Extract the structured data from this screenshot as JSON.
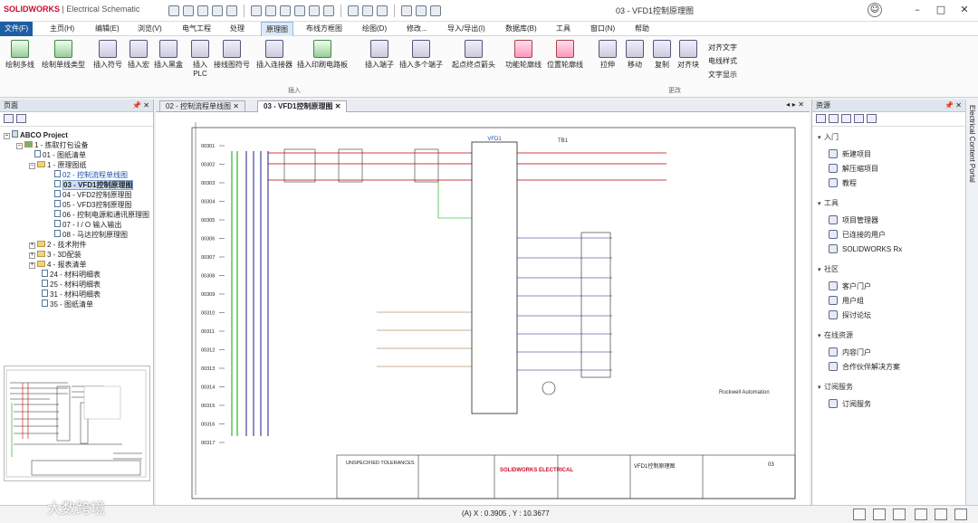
{
  "app": {
    "logo": "SOLIDWORKS",
    "logo_sub": " | Electrical Schematic",
    "window_title": "03 - VFD1控制原理图"
  },
  "menu": [
    "文件(F)",
    "主页(H)",
    "编辑(E)",
    "浏览(V)",
    "电气工程",
    "处理",
    "原理图",
    "布线方框图",
    "绘图(D)",
    "修改...",
    "导入/导出(I)",
    "数据库(B)",
    "工具",
    "窗口(N)",
    "帮助"
  ],
  "ribbon": {
    "buttons": [
      "绘制多线",
      "绘制单线类型",
      "插入符号",
      "插入宏",
      "插入黑盒",
      "插入PLC",
      "接线图符号",
      "插入连接器",
      "插入印刷电路板",
      "插入端子",
      "插入多个端子",
      "起点终点箭头",
      "功能轮廓线",
      "位置轮廓线",
      "拉伸",
      "移动",
      "复制",
      "对齐块"
    ],
    "group_insert": "插入",
    "group_change": "更改",
    "small": [
      "对齐文字",
      "电线样式",
      "文字显示"
    ]
  },
  "left": {
    "title": "页面",
    "tree": [
      {
        "text": "ABCO Project"
      },
      {
        "text": "1 - 拣取打包设备"
      },
      {
        "text": "01 - 图纸清单"
      },
      {
        "text": "1 - 原理图纸"
      },
      {
        "text": "02 - 控制流程单线图"
      },
      {
        "text": "03 - VFD1控制原理图"
      },
      {
        "text": "04 - VFD2控制原理图"
      },
      {
        "text": "05 - VFD3控制原理图"
      },
      {
        "text": "06 - 控制电源和通讯原理图"
      },
      {
        "text": "07 - I / O 输入输出"
      },
      {
        "text": "08 - 马达控制原理图"
      },
      {
        "text": "2 - 技术附件"
      },
      {
        "text": "3 - 3D配装"
      },
      {
        "text": "4 - 报表清单"
      },
      {
        "text": "24 - 材料明细表"
      },
      {
        "text": "25 - 材料明细表"
      },
      {
        "text": "31 - 材料明细表"
      },
      {
        "text": "35 - 图纸清单"
      }
    ]
  },
  "tabs": [
    "02 - 控制流程单线图",
    "03 - VFD1控制原理图"
  ],
  "schematic": {
    "rows": [
      "00301",
      "00302",
      "00303",
      "00304",
      "00305",
      "00306",
      "00307",
      "00308",
      "00309",
      "00310",
      "00311",
      "00312",
      "00313",
      "00314",
      "00315",
      "00316",
      "00317"
    ],
    "vfd_label": "VFD1",
    "tb1": "TB1",
    "rockwell": "Rockwell Automation",
    "title_block": "VFD1控制原理图",
    "sheet_no": "03",
    "company": "SOLIDWORKS ELECTRICAL",
    "tolerances": "UNSPECIFIED TOLERANCES"
  },
  "right": {
    "title": "资源",
    "sections": [
      {
        "title": "入门",
        "items": [
          "新建项目",
          "解压缩项目",
          "教程"
        ]
      },
      {
        "title": "工具",
        "items": [
          "项目管理器",
          "已连接的用户",
          "SOLIDWORKS Rx"
        ]
      },
      {
        "title": "社区",
        "items": [
          "客户门户",
          "用户组",
          "探讨论坛"
        ]
      },
      {
        "title": "在线资源",
        "items": [
          "内容门户",
          "合作伙伴解决方案"
        ]
      },
      {
        "title": "订阅服务",
        "items": [
          "订阅服务"
        ]
      }
    ],
    "vtab": "Electrical Content Portal"
  },
  "status": {
    "coords": "(A) X : 0.3905 , Y : 10.3677"
  },
  "watermark": "大数跨境"
}
